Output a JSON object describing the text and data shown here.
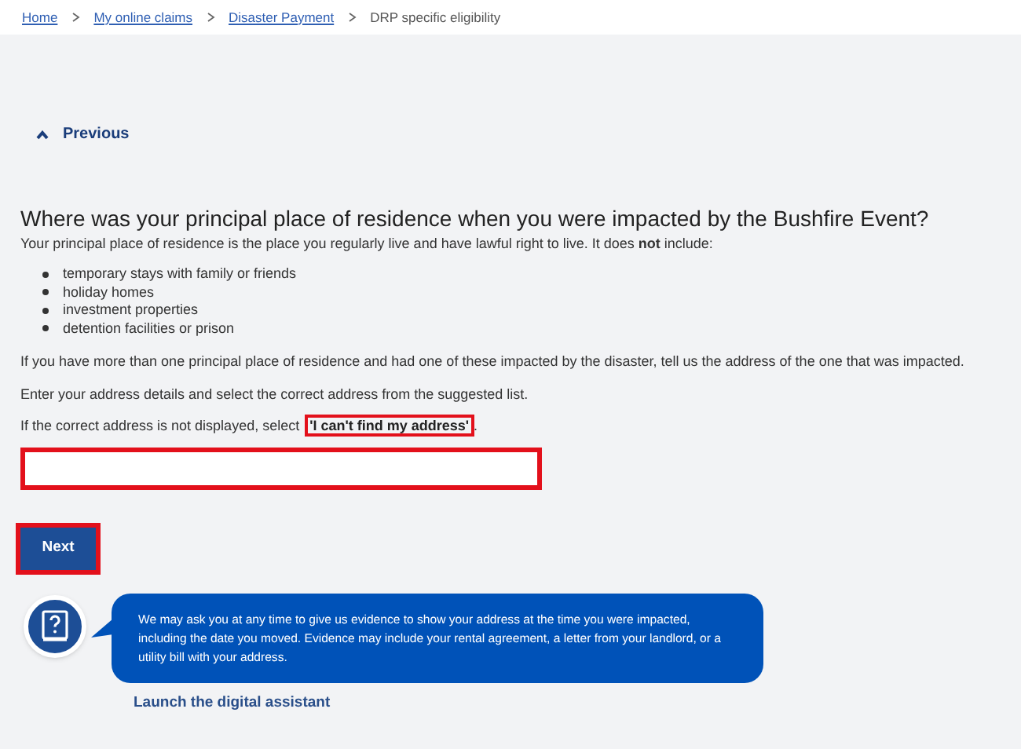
{
  "breadcrumb": [
    {
      "label": "Home",
      "link": true
    },
    {
      "label": "My online claims",
      "link": true
    },
    {
      "label": "Disaster Payment",
      "link": true
    },
    {
      "label": "DRP specific eligibility",
      "link": false
    }
  ],
  "previous": "Previous",
  "question": "Where was your principal place of residence when you were impacted by the Bushfire Event?",
  "intro": "Your principal place of residence is the place you regularly live and have lawful right to live. It does **not** include:",
  "exclusions": [
    "temporary stays with family or friends",
    "holiday homes",
    "investment properties",
    "detention facilities or prison"
  ],
  "paragraphs": [
    "If you have more than one principal place of residence and had one of these impacted by the disaster, tell us the address of the one that was impacted.",
    "Enter your address details and select the correct address from the suggested list."
  ],
  "not_found": {
    "before": "If the correct address is not displayed, select ",
    "emphasis": "'I can't find my address'",
    "after": ".",
    "highlighted": true
  },
  "address_field": {
    "highlighted": true
  },
  "next_button": {
    "label": "Next",
    "highlighted": true
  },
  "assistant": {
    "message": "We may ask you at any time to give us evidence to show your address at the time you were impacted, including the date you moved. Evidence may include your rental agreement, a letter from your landlord, or a utility bill with your address.",
    "link": "Launch the digital assistant"
  }
}
